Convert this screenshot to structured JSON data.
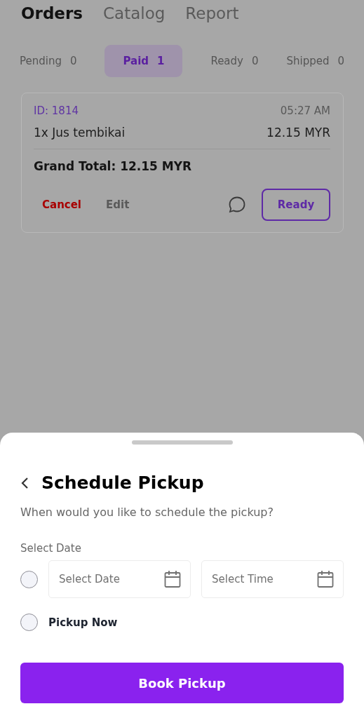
{
  "top_tabs": [
    {
      "label": "Orders",
      "selected": true
    },
    {
      "label": "Catalog",
      "selected": false
    },
    {
      "label": "Report",
      "selected": false
    }
  ],
  "status_tabs": [
    {
      "label": "Pending",
      "count": "0",
      "selected": false
    },
    {
      "label": "Paid",
      "count": "1",
      "selected": true
    },
    {
      "label": "Ready",
      "count": "0",
      "selected": false
    },
    {
      "label": "Shipped",
      "count": "0",
      "selected": false
    }
  ],
  "order": {
    "id": "ID: 1814",
    "time": "05:27 AM",
    "items": [
      {
        "name": "1x Jus tembikai",
        "price": "12.15 MYR"
      }
    ],
    "grand_total": "Grand Total: 12.15 MYR",
    "actions": {
      "cancel": "Cancel",
      "edit": "Edit",
      "ready": "Ready"
    }
  },
  "sheet": {
    "title": "Schedule Pickup",
    "question": "When would you like to schedule the pickup?",
    "section_label": "Select Date",
    "options": [
      {
        "kind": "schedule",
        "selected": false,
        "date": {
          "placeholder": "Select Date"
        },
        "time": {
          "placeholder": "Select Time"
        }
      },
      {
        "kind": "now",
        "selected": false,
        "label": "Pickup Now"
      }
    ],
    "button": "Book Pickup"
  }
}
